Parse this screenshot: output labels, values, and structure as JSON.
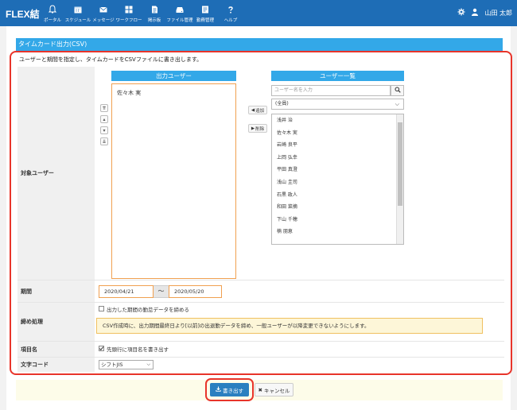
{
  "app": {
    "logo": "FLEX結"
  },
  "nav": [
    {
      "id": "portal",
      "label": "ポータル",
      "icon": "bell-icon"
    },
    {
      "id": "schedule",
      "label": "スケジュール",
      "icon": "calendar-icon"
    },
    {
      "id": "message",
      "label": "メッセージ",
      "icon": "envelope-icon"
    },
    {
      "id": "workflow",
      "label": "ワークフロー",
      "icon": "workflow-icon"
    },
    {
      "id": "board",
      "label": "掲示板",
      "icon": "board-icon"
    },
    {
      "id": "file",
      "label": "ファイル管理",
      "icon": "drive-icon"
    },
    {
      "id": "attendance",
      "label": "勤務管理",
      "icon": "attendance-icon"
    },
    {
      "id": "help",
      "label": "ヘルプ",
      "icon": "help-icon"
    }
  ],
  "header_user": {
    "name": "山田 太郎"
  },
  "page": {
    "title": "タイムカード出力(CSV)",
    "description": "ユーザーと期間を指定し、タイムカードをCSVファイルに書き出します。"
  },
  "labels": {
    "target_users": "対象ユーザー",
    "period": "期間",
    "closing": "締め処理",
    "item_name": "項目名",
    "encoding": "文字コード"
  },
  "output_users": {
    "title": "出力ユーザー",
    "items": [
      "佐々木 実"
    ]
  },
  "mid_buttons": {
    "add": "追加",
    "remove": "削除"
  },
  "user_list": {
    "title": "ユーザー一覧",
    "search_placeholder": "ユーザー名を入力",
    "filter_value": "(全員)",
    "items": [
      "浅井 治",
      "佐々木 実",
      "岩崎 良平",
      "上岡 弘幸",
      "平田 真澄",
      "浅山 圭司",
      "石黒 政人",
      "和田 菜摘",
      "下山 千穂",
      "楠 朋恵"
    ]
  },
  "period": {
    "start": "2020/04/21",
    "separator": "～",
    "end": "2020/05/20"
  },
  "closing": {
    "checkbox_label": "出力した期間の勤怠データを締める",
    "checked": false,
    "notice": "CSV作成時に、出力期間最終日より[以前]の出退勤データを締め、一般ユーザーが以降変更できないようにします。"
  },
  "item_name": {
    "checkbox_label": "先頭行に項目名を書き出す",
    "checked": true
  },
  "encoding": {
    "value": "シフトJIS"
  },
  "footer": {
    "write_label": "書き出す",
    "cancel_label": "キャンセル"
  },
  "colors": {
    "topbar": "#1e6db6",
    "accent": "#33a8e8",
    "highlight": "#e8342a"
  }
}
